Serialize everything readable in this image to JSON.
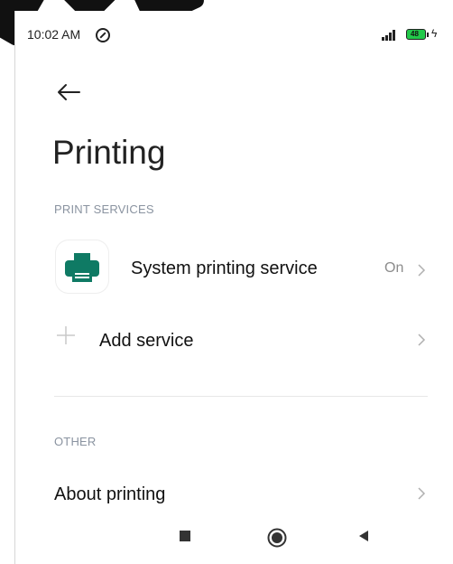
{
  "status_bar": {
    "time": "10:02 AM",
    "battery_level": "48",
    "signal_icon": "signal-icon",
    "battery_icon": "battery-icon"
  },
  "header": {
    "title": "Printing"
  },
  "sections": {
    "print_services_label": "PRINT SERVICES",
    "other_label": "OTHER"
  },
  "items": {
    "system_printing_service": {
      "label": "System printing service",
      "status": "On"
    },
    "add_service": {
      "label": "Add service"
    },
    "about_printing": {
      "label": "About printing"
    }
  },
  "colors": {
    "printer_icon": "#0f7a64",
    "battery": "#22c94a"
  }
}
